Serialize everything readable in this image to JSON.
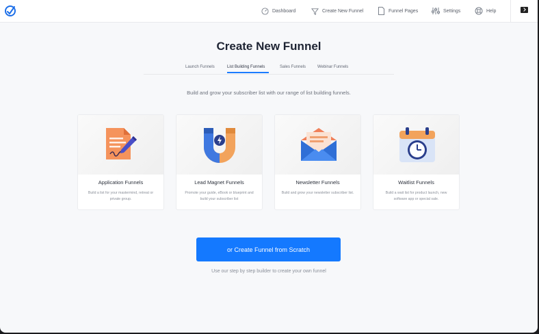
{
  "nav": {
    "items": [
      {
        "label": "Dashboard",
        "icon": "gauge-icon"
      },
      {
        "label": "Create New Funnel",
        "icon": "funnel-icon"
      },
      {
        "label": "Funnel Pages",
        "icon": "page-icon"
      },
      {
        "label": "Settings",
        "icon": "sliders-icon"
      },
      {
        "label": "Help",
        "icon": "lifebuoy-icon"
      }
    ]
  },
  "page": {
    "title": "Create New Funnel",
    "subtitle": "Build and grow your subscriber list with our range of list building funnels."
  },
  "tabs": [
    {
      "label": "Launch Funnels",
      "active": false
    },
    {
      "label": "List Building Funnels",
      "active": true
    },
    {
      "label": "Sales Funnels",
      "active": false
    },
    {
      "label": "Webinar Funnels",
      "active": false
    }
  ],
  "cards": [
    {
      "title": "Application Funnels",
      "desc": "Build a list for your mastermind, retreat or private group.",
      "icon": "application-document-icon"
    },
    {
      "title": "Lead Magnet Funnels",
      "desc": "Promote your guide, eBook or blueprint and build your subscriber list",
      "icon": "magnet-icon"
    },
    {
      "title": "Newsletter Funnels",
      "desc": "Build and grow your newsletter subscriber list.",
      "icon": "envelope-icon"
    },
    {
      "title": "Waitlist Funnels",
      "desc": "Build a wait list for product launch, new software app or special sale.",
      "icon": "calendar-clock-icon"
    }
  ],
  "cta": {
    "label": "or Create Funnel from Scratch",
    "sub": "Use our step by step builder to create your own funnel"
  },
  "colors": {
    "accent": "#1479ff",
    "background": "#f7f8fa"
  }
}
